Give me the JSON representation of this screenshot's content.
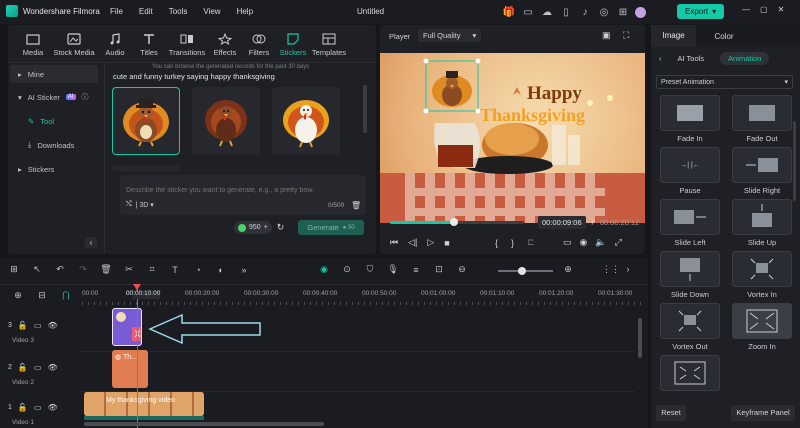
{
  "app": {
    "name": "Wondershare Filmora",
    "title": "Untitled",
    "export_label": "Export"
  },
  "menu": [
    "File",
    "Edit",
    "Tools",
    "View",
    "Help"
  ],
  "media_tabs": [
    {
      "label": "Media",
      "icon": "media-icon"
    },
    {
      "label": "Stock Media",
      "icon": "stock-media-icon"
    },
    {
      "label": "Audio",
      "icon": "audio-icon"
    },
    {
      "label": "Titles",
      "icon": "titles-icon"
    },
    {
      "label": "Transitions",
      "icon": "transitions-icon"
    },
    {
      "label": "Effects",
      "icon": "effects-icon"
    },
    {
      "label": "Filters",
      "icon": "filters-icon"
    },
    {
      "label": "Stickers",
      "icon": "stickers-icon"
    },
    {
      "label": "Templates",
      "icon": "templates-icon"
    }
  ],
  "sidebar": {
    "items": [
      {
        "label": "Mine"
      },
      {
        "label": "AI Sticker",
        "badge": "AI"
      },
      {
        "label": "Tool"
      },
      {
        "label": "Downloads"
      },
      {
        "label": "Stickers"
      }
    ]
  },
  "sticker": {
    "hint": "You can browse the generated records for the past 30 days",
    "prompt": "cute and funny turkey saying happy thanksgiving",
    "input_placeholder": "Describe the sticker you want to generate, e.g., a pretty bow.",
    "ratio": "3D",
    "counter": "0/500",
    "credits": "950",
    "generate_label": "Generate"
  },
  "player": {
    "label": "Player",
    "quality": "Full Quality",
    "current_time": "00:00:09:06",
    "total_time": "00:00:20:12",
    "progress": 0.48,
    "preview_text_1": "Happy",
    "preview_text_2": "Thanksgiving"
  },
  "right_panel": {
    "tabs": [
      "Image",
      "Color"
    ],
    "subtabs": [
      "AI Tools",
      "Animation"
    ],
    "preset_label": "Preset Animation",
    "animations": [
      "Fade In",
      "Fade Out",
      "Pause",
      "Slide Right",
      "Slide Left",
      "Slide Up",
      "Slide Down",
      "Vortex In",
      "Vortex Out",
      "Zoom In",
      ""
    ],
    "reset_label": "Reset",
    "keyframe_label": "Keyframe Panel"
  },
  "timeline": {
    "ruler": [
      "00:00",
      "00:00:10:00",
      "00:00:20:00",
      "00:00:30:00",
      "00:00:40:00",
      "00:00:50:00",
      "00:01:00:00",
      "00:01:10:00",
      "00:01:20:00",
      "00:01:30:00"
    ],
    "tracks": [
      {
        "label": "Video 3",
        "num": "3"
      },
      {
        "label": "Video 2",
        "num": "2"
      },
      {
        "label": "Video 1",
        "num": "1"
      }
    ],
    "clip_v2": "Th...",
    "clip_v1": "My thanksgiving video"
  },
  "colors": {
    "accent": "#15c9a6",
    "clip_purple": "#7a5bd6",
    "clip_orange": "#e27d52"
  }
}
